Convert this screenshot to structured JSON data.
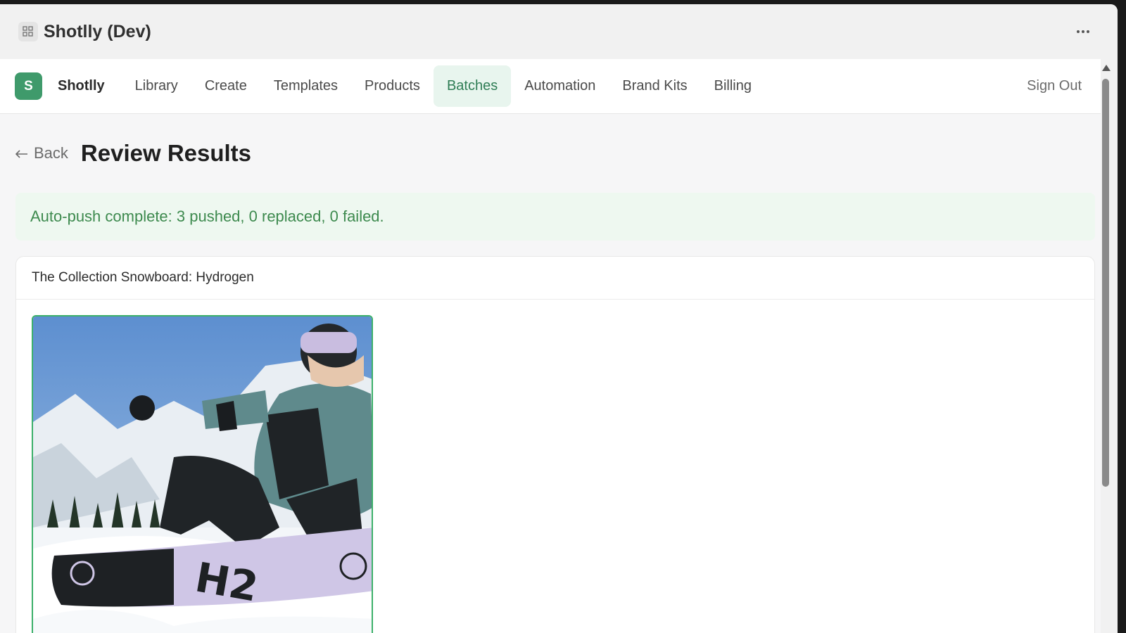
{
  "window": {
    "title": "Shotlly (Dev)"
  },
  "nav": {
    "logo_letter": "S",
    "brand": "Shotlly",
    "items": [
      {
        "label": "Library",
        "active": false
      },
      {
        "label": "Create",
        "active": false
      },
      {
        "label": "Templates",
        "active": false
      },
      {
        "label": "Products",
        "active": false
      },
      {
        "label": "Batches",
        "active": true
      },
      {
        "label": "Automation",
        "active": false
      },
      {
        "label": "Brand Kits",
        "active": false
      },
      {
        "label": "Billing",
        "active": false
      }
    ],
    "sign_out": "Sign Out"
  },
  "page": {
    "back_label": "Back",
    "title": "Review Results"
  },
  "banner": {
    "message": "Auto-push complete: 3 pushed, 0 replaced, 0 failed."
  },
  "product_card": {
    "title": "The Collection Snowboard: Hydrogen",
    "image": {
      "board_text": "H2"
    }
  },
  "colors": {
    "accent": "#3f9a6b",
    "active_nav_bg": "#e8f5ee",
    "banner_bg": "#eef8f0",
    "banner_text": "#3d8a4e",
    "selected_border": "#3cb06a"
  },
  "icons": {
    "app": "app-grid-icon",
    "more": "more-horizontal-icon",
    "back": "arrow-left-icon"
  }
}
